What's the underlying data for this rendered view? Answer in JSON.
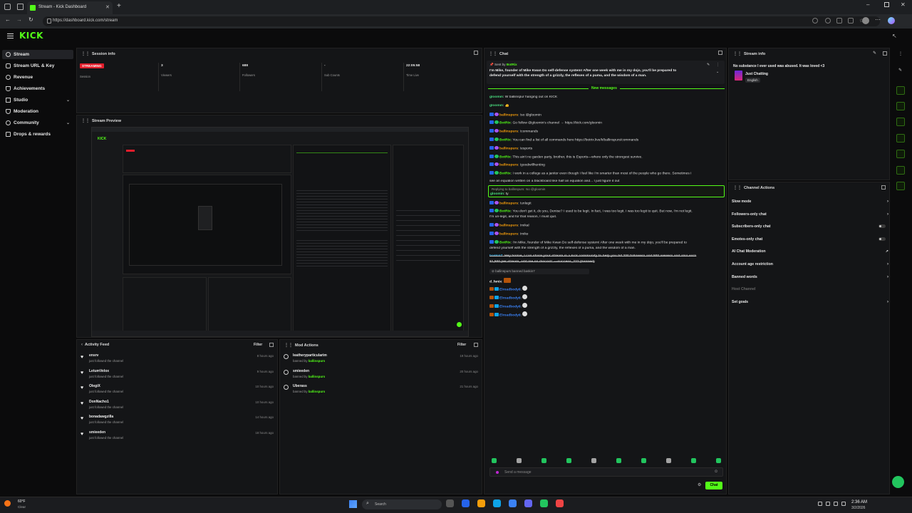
{
  "browser": {
    "tab_title": "Stream - Kick Dashboard",
    "url": "https://dashboard.kick.com/stream"
  },
  "app": {
    "logo": "KICK"
  },
  "sidebar": {
    "items": [
      {
        "label": "Stream",
        "icon": "broadcast-icon"
      },
      {
        "label": "Stream URL & Key",
        "icon": "key-icon"
      },
      {
        "label": "Revenue",
        "icon": "dollar-icon"
      },
      {
        "label": "Achievements",
        "icon": "trophy-icon"
      },
      {
        "label": "Studio",
        "icon": "studio-icon"
      },
      {
        "label": "Moderation",
        "icon": "shield-icon"
      },
      {
        "label": "Community",
        "icon": "people-icon"
      },
      {
        "label": "Drops & rewards",
        "icon": "gift-icon"
      }
    ]
  },
  "session": {
    "title": "Session info",
    "badge": "STREAMING",
    "session_label": "Session",
    "viewers_value": "3",
    "viewers_label": "Viewers",
    "followers_value": "688",
    "followers_label": "Followers",
    "subs_value": "-",
    "subs_label": "Sub Counts",
    "time_value": "22:05:58",
    "time_label": "Time Live"
  },
  "preview": {
    "title": "Stream Preview"
  },
  "activity": {
    "title": "Activity Feed",
    "filter": "Filter",
    "items": [
      {
        "name": "ensrv",
        "action": "just followed the channel",
        "time": "8 hours ago"
      },
      {
        "name": "LetumVelox",
        "action": "just followed the channel",
        "time": "9 hours ago"
      },
      {
        "name": "OlegiX",
        "action": "just followed the channel",
        "time": "10 hours ago"
      },
      {
        "name": "DonNacho1",
        "action": "just followed the channel",
        "time": "10 hours ago"
      },
      {
        "name": "bonadawgzilla",
        "action": "just followed the channel",
        "time": "14 hours ago"
      },
      {
        "name": "smieeden",
        "action": "just followed the channel",
        "time": "18 hours ago"
      }
    ]
  },
  "mod": {
    "title": "Mod Actions",
    "filter": "Filter",
    "items": [
      {
        "name": "leatheryparticularim",
        "by_prefix": "banned by",
        "by": "ballinspurs",
        "time": "19 hours ago"
      },
      {
        "name": "smieeden",
        "by_prefix": "banned by",
        "by": "ballinspurs",
        "time": "20 hours ago"
      },
      {
        "name": "Uberass",
        "by_prefix": "banned by",
        "by": "ballinspurs",
        "time": "21 hours ago"
      }
    ]
  },
  "chat": {
    "title": "Chat",
    "pinned_by": "Sent by",
    "pinned_user": "BotRix",
    "pinned_text_1": "I'm Mike, founder of Mike Kwan Do self-defense system! After one week with me in my dojo, you'll be prepared to",
    "pinned_text_2": "defend yourself with the strength of a grizzly, the reflexes of a puma, and the wisdom of a man.",
    "new_messages": "New messages",
    "messages": [
      {
        "user": "gloomin",
        "color": "#4ade80",
        "text": "W ballinspur hanging out on KICK"
      },
      {
        "user": "gloomin",
        "color": "#4ade80",
        "text": "👍"
      },
      {
        "user": "ballinspurs",
        "color": "#f59e0b",
        "text": "!so @gloomin"
      },
      {
        "user": "BotRix",
        "color": "#53fc18",
        "text": "Go follow @gloomin's channel → https://kick.com/gloomin"
      },
      {
        "user": "ballinspurs",
        "color": "#f59e0b",
        "text": "!commands"
      },
      {
        "user": "BotRix",
        "color": "#53fc18",
        "text": "You can find a list of all commands here https://botrix.live/k/ballinspurs/commands"
      },
      {
        "user": "ballinspurs",
        "color": "#f59e0b",
        "text": "!esports"
      },
      {
        "user": "BotRix",
        "color": "#53fc18",
        "text": "This ain't no garden party, brother, this is Esports—where only the strongest survive."
      },
      {
        "user": "ballinspurs",
        "color": "#f59e0b",
        "text": "!goodwillhunting"
      },
      {
        "user": "BotRix",
        "color": "#53fc18",
        "text": "I work in a college as a janitor even though I feel like I'm smarter than most of the people who go there. Sometimes I"
      },
      {
        "user": "",
        "color": "#dedede",
        "text": "see an equation written on a blackboard like half an equation and... I just figure it out"
      }
    ],
    "reply_context": "Replying to ballinspurs: !so @gloomin",
    "reply_user": "gloomin",
    "reply_text": "ty",
    "messages2": [
      {
        "user": "ballinspurs",
        "color": "#f59e0b",
        "text": "!unlegit"
      },
      {
        "user": "BotRix",
        "color": "#53fc18",
        "text": "You don't get it, do you, Denise? I used to be legit. In fact, I was too legit. I was too legit to quit. But now, I'm not legit."
      },
      {
        "user": "",
        "color": "#dedede",
        "text": "I'm un-legit, and for that reason, I must quit."
      },
      {
        "user": "ballinspurs",
        "color": "#f59e0b",
        "text": "!mikal"
      },
      {
        "user": "ballinspurs",
        "color": "#f59e0b",
        "text": "!mike"
      },
      {
        "user": "BotRix",
        "color": "#53fc18",
        "text": "I'm Mike, founder of Mike Kwan Do self-defense system! After one week with me in my dojo, you'll be prepared to"
      },
      {
        "user": "",
        "color": "#dedede",
        "text": "defend yourself with the strength of a grizzly, the reflexes of a puma, and the wisdom of a man."
      }
    ],
    "spam_user": "baskin7",
    "spam_text_1": "Hey homie, I can share your stream in a kick community to help you hit 200 followers and 500 viewers and also earn",
    "spam_text_2": "$1,500 per stream, add me on discord: ---success_222 (banned)",
    "ban_notice": "ballinspurs banned baskin7",
    "emote_user": "d_fenix",
    "emote_rows": [
      "Elroadbody6",
      "Elroadbody6",
      "Elroadbody6",
      "Elroadbody6"
    ],
    "input_placeholder": "Send a message",
    "send_label": "Chat"
  },
  "stream_info": {
    "title": "Stream info",
    "stream_title": "No substance I ever used was abused. It was loved <3",
    "category": "Just Chatting",
    "language": "English"
  },
  "channel_actions": {
    "title": "Channel Actions",
    "items": [
      {
        "label": "Slow mode",
        "control": "arrow"
      },
      {
        "label": "Followers-only chat",
        "control": "arrow"
      },
      {
        "label": "Subscribers-only chat",
        "control": "toggle"
      },
      {
        "label": "Emotes-only chat",
        "control": "toggle"
      },
      {
        "label": "AI Chat Moderation",
        "control": "link"
      },
      {
        "label": "Account age restriction",
        "control": "arrow"
      },
      {
        "label": "Banned words",
        "control": "arrow"
      },
      {
        "label": "Host Channel",
        "control": "none"
      },
      {
        "label": "Set goals",
        "control": "arrow"
      }
    ]
  },
  "taskbar": {
    "weather_temp": "60°F",
    "weather_text": "Clear",
    "search": "Search",
    "time": "2:36 AM",
    "date": "3/2/2026"
  },
  "colors": {
    "brand": "#53fc18",
    "streaming": "#e11d2b",
    "bg": "#0b0b0c",
    "panel": "#141517"
  }
}
